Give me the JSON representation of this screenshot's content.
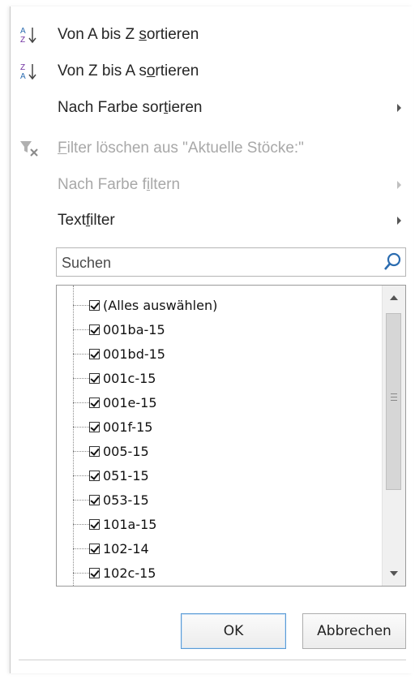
{
  "menu": {
    "sort_az": {
      "before": "Von A bis Z ",
      "accel": "s",
      "after": "ortieren",
      "icon": "sort-ascending-icon"
    },
    "sort_za": {
      "before": "Von Z bis A s",
      "accel": "o",
      "after": "rtieren",
      "icon": "sort-descending-icon"
    },
    "sort_color": {
      "before": "Nach Farbe sor",
      "accel": "t",
      "after": "ieren"
    },
    "clear_filter": {
      "before": "",
      "accel": "F",
      "after": "ilter löschen aus \"Aktuelle Stöcke:\"",
      "icon": "clear-filter-icon"
    },
    "filter_color": {
      "before": "Nach Farbe f",
      "accel": "i",
      "after": "ltern"
    },
    "text_filter": {
      "before": "Text",
      "accel": "f",
      "after": "ilter"
    }
  },
  "search": {
    "placeholder": "Suchen",
    "value": ""
  },
  "list": {
    "items": [
      "(Alles auswählen)",
      "001ba-15",
      "001bd-15",
      "001c-15",
      "001e-15",
      "001f-15",
      "005-15",
      "051-15",
      "053-15",
      "101a-15",
      "102-14",
      "102c-15"
    ]
  },
  "buttons": {
    "ok": "OK",
    "cancel": "Abbrechen"
  },
  "colors": {
    "accent": "#5b9bd5",
    "search_icon": "#2b6cb0",
    "disabled_text": "#a8a8a8"
  }
}
